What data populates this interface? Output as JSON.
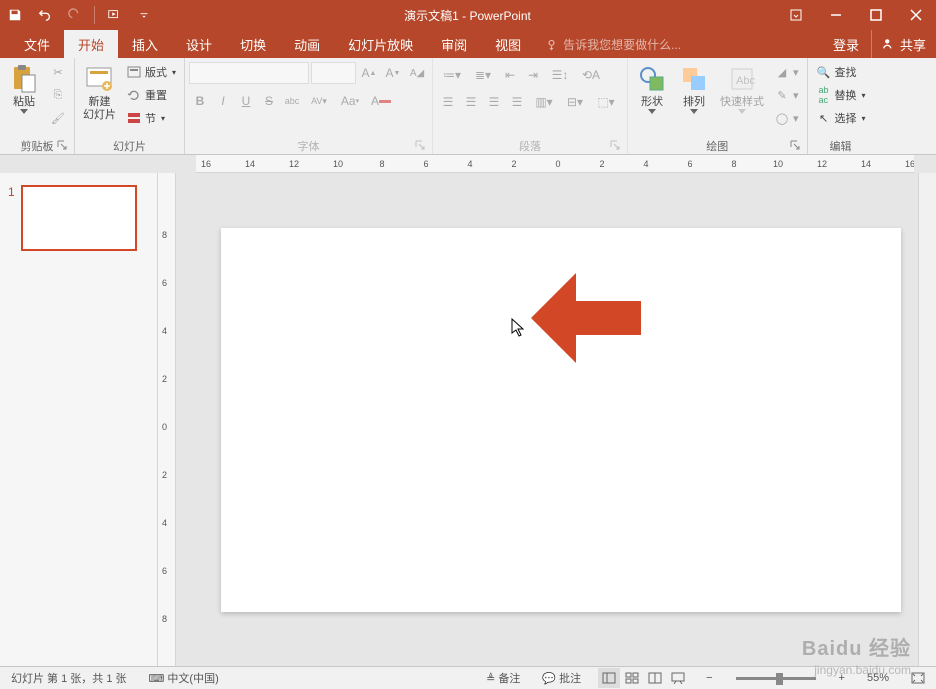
{
  "app": {
    "title": "演示文稿1 - PowerPoint"
  },
  "tabs": {
    "file": "文件",
    "home": "开始",
    "insert": "插入",
    "design": "设计",
    "transition": "切换",
    "animation": "动画",
    "slideshow": "幻灯片放映",
    "review": "审阅",
    "view": "视图",
    "tellme": "告诉我您想要做什么...",
    "login": "登录",
    "share": "共享"
  },
  "ribbon": {
    "clipboard": {
      "paste": "粘贴",
      "label": "剪贴板"
    },
    "slides": {
      "new": "新建\n幻灯片",
      "layout": "版式",
      "reset": "重置",
      "section": "节",
      "label": "幻灯片"
    },
    "font": {
      "label": "字体",
      "bold": "B",
      "italic": "I",
      "underline": "U",
      "strike": "S",
      "shadow": "abc",
      "spacing": "AV",
      "case": "Aa"
    },
    "paragraph": {
      "label": "段落"
    },
    "drawing": {
      "shapes": "形状",
      "arrange": "排列",
      "quickstyle": "快速样式",
      "label": "绘图"
    },
    "editing": {
      "find": "查找",
      "replace": "替换",
      "select": "选择",
      "label": "编辑"
    }
  },
  "ruler": {
    "h_ticks": [
      "16",
      "14",
      "12",
      "10",
      "8",
      "6",
      "4",
      "2",
      "0",
      "2",
      "4",
      "6",
      "8",
      "10",
      "12",
      "14",
      "16"
    ],
    "v_ticks": [
      "8",
      "6",
      "4",
      "2",
      "0",
      "2",
      "4",
      "6",
      "8"
    ]
  },
  "thumbnails": {
    "slide1_num": "1"
  },
  "statusbar": {
    "slide_info": "幻灯片 第 1 张，共 1 张",
    "language": "中文(中国)",
    "notes": "备注",
    "comments": "批注",
    "zoom": "55%"
  },
  "watermark": {
    "main": "Baidu 经验",
    "sub": "jingyan.baidu.com"
  },
  "colors": {
    "brand": "#b7472a",
    "arrow": "#d24726"
  }
}
